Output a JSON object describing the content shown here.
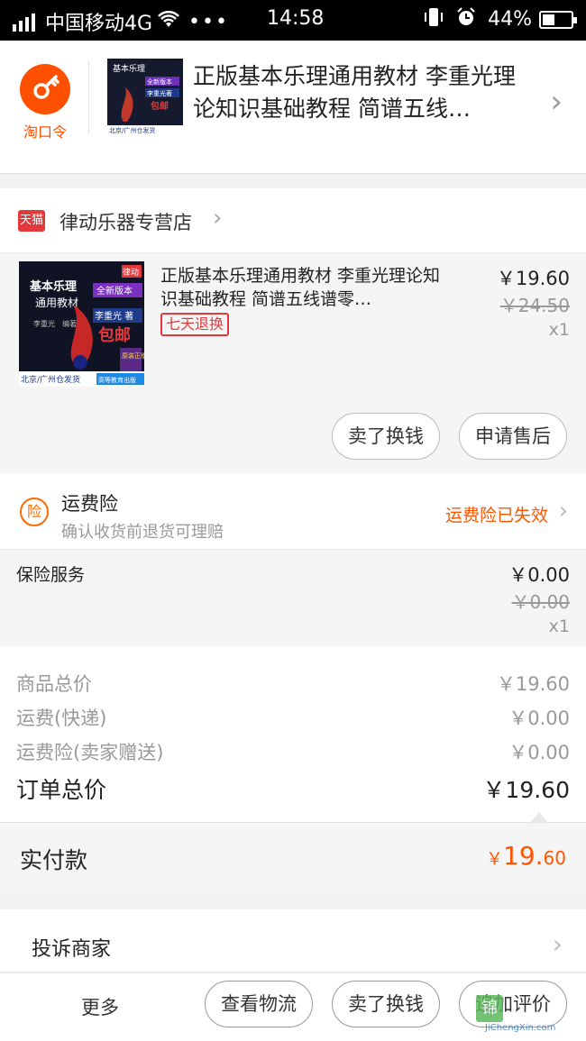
{
  "status_bar": {
    "carrier": "中国移动4G",
    "dots": "•••",
    "time": "14:58",
    "battery": "44%",
    "battery_level": 0.44
  },
  "taokouling": {
    "logo_label": "淘口令",
    "title": "正版基本乐理通用教材 李重光理论知识基础教程 简谱五线…",
    "thumb": {
      "line1": "基本乐理",
      "line2": "全新版本",
      "line3": "李重光著",
      "line4": "包邮",
      "bottom": "北京/广州仓发货"
    }
  },
  "store": {
    "badge": "天猫",
    "name": "律动乐器专营店"
  },
  "product": {
    "title": "正版基本乐理通用教材 李重光理论知识基础教程 简谱五线谱零…",
    "tag": "七天退换",
    "price": "￥19.60",
    "original_price": "￥24.50",
    "quantity": "x1",
    "buttons": {
      "exchange": "卖了换钱",
      "after_sale": "申请售后"
    },
    "thumb": {
      "t1": "基本乐理",
      "t2": "通用教材",
      "t3": "全新版本",
      "t4": "李重光 著",
      "t5": "包邮",
      "t6": "原装正版",
      "t7": "北京/广州仓发货",
      "t8": "高等教育出版",
      "author": "李重光　编著",
      "brand": "律动"
    }
  },
  "insurance": {
    "icon_char": "险",
    "title": "运费险",
    "subtitle": "确认收货前退货可理赔",
    "status": "运费险已失效"
  },
  "service": {
    "name": "保险服务",
    "price": "￥0.00",
    "original_price": "￥0.00",
    "quantity": "x1"
  },
  "totals": {
    "goods_label": "商品总价",
    "goods_value": "￥19.60",
    "shipping_label": "运费(快递)",
    "shipping_value": "￥0.00",
    "ins_label": "运费险(卖家赠送)",
    "ins_value": "￥0.00",
    "order_label": "订单总价",
    "order_value": "￥19.60"
  },
  "paid": {
    "label": "实付款",
    "symbol": "￥",
    "integer": "19.",
    "decimal": "60"
  },
  "complaint": {
    "label": "投诉商家"
  },
  "bottom_bar": {
    "more": "更多",
    "logistics": "查看物流",
    "exchange": "卖了换钱",
    "review": "追加评价"
  },
  "watermark": {
    "text": "JiChengXin.com",
    "box": "锦"
  },
  "colors": {
    "accent": "#ff5500",
    "tmall_red": "#e4393c",
    "brand_orange": "#ff5000"
  }
}
